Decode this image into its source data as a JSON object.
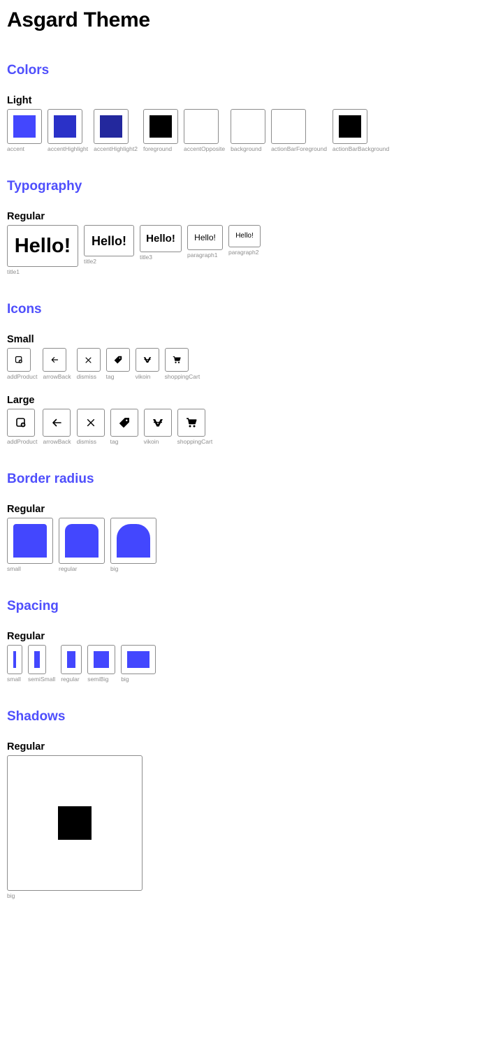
{
  "page": {
    "title": "Asgard Theme"
  },
  "sections": {
    "colors": {
      "title": "Colors",
      "group": "Light",
      "items": [
        {
          "label": "accent",
          "color": "#4347fe"
        },
        {
          "label": "accentHighlight",
          "color": "#2a31c8"
        },
        {
          "label": "accentHighlight2",
          "color": "#23289d"
        },
        {
          "label": "foreground",
          "color": "#000000"
        },
        {
          "label": "accentOpposite",
          "color": "#ffffff"
        },
        {
          "label": "background",
          "color": "#ffffff"
        },
        {
          "label": "actionBarForeground",
          "color": "#ffffff"
        },
        {
          "label": "actionBarBackground",
          "color": "#000000"
        }
      ]
    },
    "typography": {
      "title": "Typography",
      "group": "Regular",
      "sample": "Hello!",
      "items": [
        {
          "label": "title1"
        },
        {
          "label": "title2"
        },
        {
          "label": "title3"
        },
        {
          "label": "paragraph1"
        },
        {
          "label": "paragraph2"
        }
      ]
    },
    "icons": {
      "title": "Icons",
      "small_group": "Small",
      "large_group": "Large",
      "items": [
        {
          "label": "addProduct",
          "icon": "add-product-icon"
        },
        {
          "label": "arrowBack",
          "icon": "arrow-back-icon"
        },
        {
          "label": "dismiss",
          "icon": "dismiss-icon"
        },
        {
          "label": "tag",
          "icon": "tag-icon"
        },
        {
          "label": "vikoin",
          "icon": "vikoin-icon"
        },
        {
          "label": "shoppingCart",
          "icon": "shopping-cart-icon"
        }
      ]
    },
    "border_radius": {
      "title": "Border radius",
      "group": "Regular",
      "items": [
        {
          "label": "small"
        },
        {
          "label": "regular"
        },
        {
          "label": "big"
        }
      ]
    },
    "spacing": {
      "title": "Spacing",
      "group": "Regular",
      "items": [
        {
          "label": "small"
        },
        {
          "label": "semiSmall"
        },
        {
          "label": "regular"
        },
        {
          "label": "semiBig"
        },
        {
          "label": "big"
        }
      ]
    },
    "shadows": {
      "title": "Shadows",
      "group": "Regular",
      "items": [
        {
          "label": "big"
        }
      ]
    }
  }
}
